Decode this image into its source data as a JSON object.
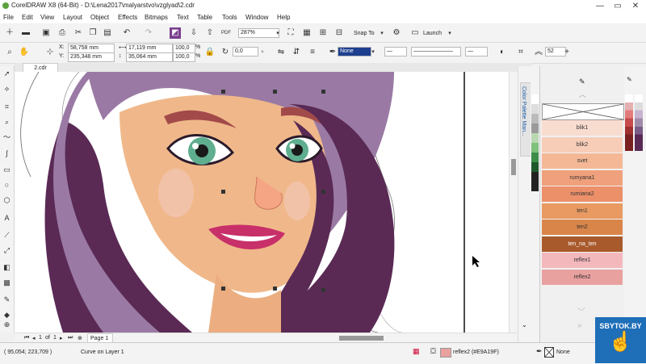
{
  "window": {
    "title": "CorelDRAW X8 (64-Bit) - D:\\Lena2017\\malyarstvo\\vzglyad\\2.cdr",
    "minimize": "—",
    "maximize": "▭",
    "close": "✕"
  },
  "menu": [
    "File",
    "Edit",
    "View",
    "Layout",
    "Object",
    "Effects",
    "Bitmaps",
    "Text",
    "Table",
    "Tools",
    "Window",
    "Help"
  ],
  "toolbar": {
    "zoom": "287%",
    "snap_to": "Snap To",
    "launch": "Launch"
  },
  "property_bar": {
    "x": "58,758 mm",
    "y": "235,348 mm",
    "width": "17,119 mm",
    "height": "35,064 mm",
    "scale_x": "100,0",
    "scale_y": "100,0",
    "percent": "%",
    "rotation": "0,0",
    "fill": "None",
    "nodes": "52"
  },
  "document": {
    "tab": "2.cdr",
    "page_label": "Page 1",
    "page_current": "1",
    "page_of": "of",
    "page_total": "1"
  },
  "docker": {
    "title": "Color Palette Man...",
    "swatches": [
      {
        "name": "blik1",
        "color": "#f9dcd0"
      },
      {
        "name": "blik2",
        "color": "#f7cdb8"
      },
      {
        "name": "svet",
        "color": "#f4b896"
      },
      {
        "name": "rumyana1",
        "color": "#f0a07c"
      },
      {
        "name": "rumiana2",
        "color": "#ec906a"
      },
      {
        "name": "ten1",
        "color": "#e99a62"
      },
      {
        "name": "ten2",
        "color": "#d9854a"
      },
      {
        "name": "ten_na_ten",
        "color": "#a95a2c"
      },
      {
        "name": "reflex1",
        "color": "#f3b8bc"
      },
      {
        "name": "reflex2",
        "color": "#e9a19f"
      }
    ]
  },
  "status": {
    "coords": "( 95,054; 223,709 )",
    "object": "Curve on Layer 1",
    "fill_name": "reflex2 (#E9A19F)",
    "outline": "None"
  },
  "watermark": "SBYTOK.BY"
}
